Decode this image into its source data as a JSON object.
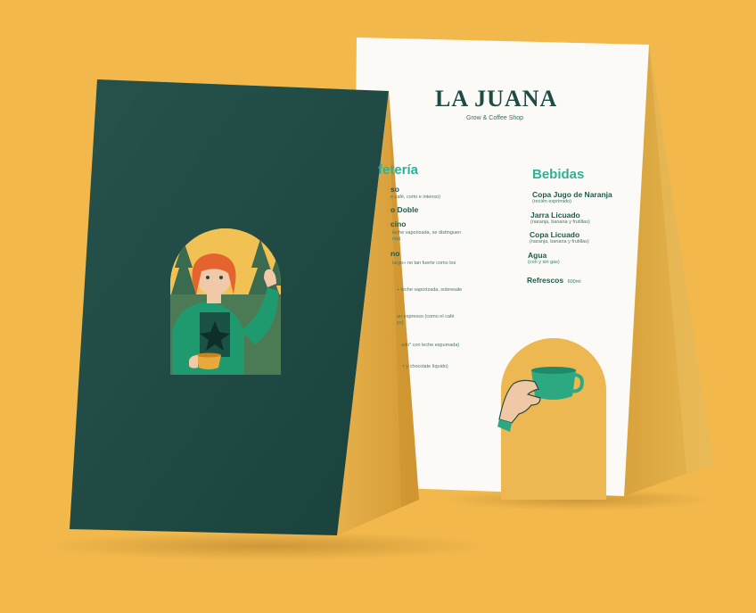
{
  "brand": {
    "name": "LA JUANA",
    "tagline": "Grow & Coffee Shop"
  },
  "menu": {
    "cafeteria": {
      "title": "fetería",
      "lines": [
        "so",
        "e café, corto e intenso)",
        "o Doble",
        "cino",
        "leche vaporizada, se distinguen",
        "res)",
        "no",
        "largo» no tan fuerte como los",
        "+ leche vaporizada, sobresale",
        "an espresso (como el café",
        "yo)",
        "ado\" con leche espumada)",
        "r y chocolate líquido)"
      ]
    },
    "bebidas": {
      "title": "Bebidas",
      "items": [
        {
          "name": "Copa Jugo de Naranja",
          "desc": "(recién exprimido)"
        },
        {
          "name": "Jarra Licuado",
          "desc": "(naranja, banana y frutillas)"
        },
        {
          "name": "Copa Licuado",
          "desc": "(naranja, banana y frutillas)"
        },
        {
          "name": "Agua",
          "desc": "(con y sin gas)"
        },
        {
          "name": "Refrescos",
          "desc": "",
          "price": "600ml"
        }
      ]
    }
  },
  "colors": {
    "background": "#F2B84C",
    "cover_green": "#1F4A45",
    "accent_teal": "#2CB396",
    "card_white": "#FBFAF6"
  }
}
